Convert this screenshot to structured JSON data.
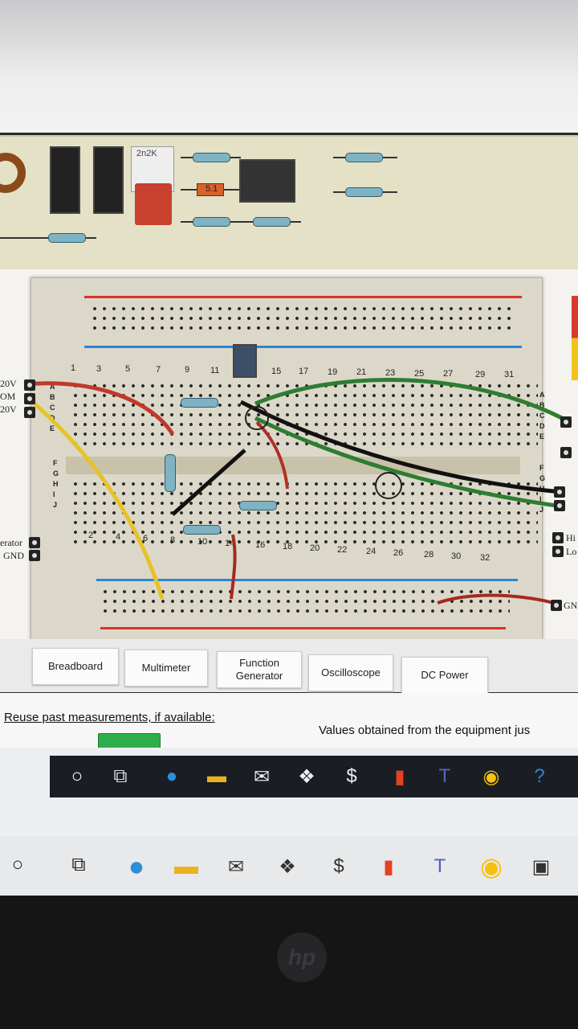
{
  "component_tray": {
    "chip_label": "2n2K",
    "diode_label": "5.1"
  },
  "breadboard": {
    "top_column_numbers": [
      "1",
      "3",
      "5",
      "7",
      "9",
      "11",
      "15",
      "17",
      "19",
      "21",
      "23",
      "25",
      "27",
      "29",
      "31"
    ],
    "bottom_column_numbers": [
      "2",
      "4",
      "6",
      "8",
      "10",
      "14",
      "16",
      "18",
      "20",
      "22",
      "24",
      "26",
      "28",
      "30",
      "32"
    ],
    "left_row_letters": [
      "A",
      "B",
      "C",
      "D",
      "E",
      "F",
      "G",
      "H",
      "I",
      "J"
    ],
    "right_row_letters": [
      "A",
      "B",
      "C",
      "D",
      "E",
      "F",
      "G",
      "H",
      "I",
      "J"
    ]
  },
  "power_labels_left": [
    "20V",
    "OM",
    "20V"
  ],
  "generator_labels": [
    "erator",
    "GND"
  ],
  "right_labels": [
    "Hi",
    "Lo",
    "GN"
  ],
  "tabs": {
    "breadboard": "Breadboard",
    "multimeter": "Multimeter",
    "function_generator": "Function Generator",
    "oscilloscope": "Oscilloscope",
    "dc_power": "DC Power"
  },
  "options": {
    "reuse_label": "Reuse past measurements, if available:",
    "values_label": "Values obtained from the equipment jus"
  },
  "taskbar_icons": [
    "cortana-circle-icon",
    "task-view-icon",
    "edge-icon",
    "file-explorer-icon",
    "mail-icon",
    "dropbox-icon",
    "sketch-icon",
    "office-icon",
    "teams-icon",
    "chrome-icon",
    "help-icon"
  ],
  "colors": {
    "wire_red": "#c0392b",
    "wire_yellow": "#e6c229",
    "wire_green": "#2e7d32",
    "wire_black": "#111111",
    "rail_red": "#d9342b",
    "rail_blue": "#2a86d6",
    "toggle_green": "#2eae4a"
  }
}
